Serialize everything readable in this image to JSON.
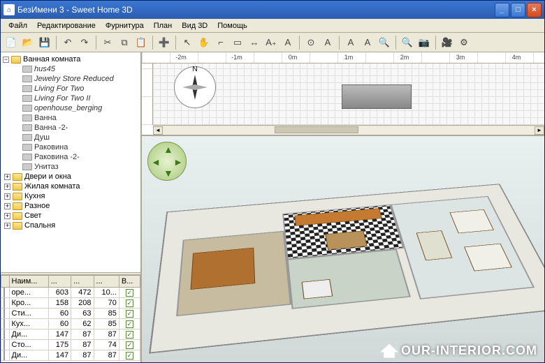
{
  "window": {
    "title": "БезИмени 3 - Sweet Home 3D"
  },
  "menubar": [
    "Файл",
    "Редактирование",
    "Фурнитура",
    "План",
    "Вид 3D",
    "Помощь"
  ],
  "toolbar_icons": [
    "new-file-icon",
    "open-icon",
    "save-icon",
    "undo-icon",
    "redo-icon",
    "cut-icon",
    "copy-icon",
    "paste-icon",
    "add-furniture-icon",
    "pointer-icon",
    "pan-icon",
    "wall-icon",
    "room-icon",
    "dimension-icon",
    "text-icon",
    "label-icon",
    "compass-icon",
    "text-edit-icon",
    "bold-icon",
    "italic-icon",
    "zoom-in-icon",
    "zoom-out-icon",
    "snapshot-icon",
    "camera-icon",
    "preferences-icon"
  ],
  "toolbar_glyphs": [
    "📄",
    "📂",
    "💾",
    "↶",
    "↷",
    "✂",
    "⧉",
    "📋",
    "➕",
    "↖",
    "✋",
    "⌐",
    "▭",
    "↔",
    "A₊",
    "A",
    "⊙",
    "A",
    "A",
    "A",
    "🔍",
    "🔍",
    "📷",
    "🎥",
    "⚙"
  ],
  "tree": {
    "root": "Ванная комната",
    "children_italic": [
      "hus45",
      "Jewelry Store Reduced",
      "Living For Two",
      "Living For Two II",
      "openhouse_berging"
    ],
    "children_plain": [
      "Ванна",
      "Ванна -2-",
      "Душ",
      "Раковина",
      "Раковина -2-",
      "Унитаз"
    ],
    "categories": [
      "Двери и окна",
      "Жилая комната",
      "Кухня",
      "Разное",
      "Свет",
      "Спальня"
    ]
  },
  "table": {
    "headers": [
      "",
      "Наим...",
      "...",
      "...",
      "...",
      "В..."
    ],
    "rows": [
      {
        "name": "оре...",
        "c1": "603",
        "c2": "472",
        "c3": "10...",
        "v": true
      },
      {
        "name": "Кро...",
        "c1": "158",
        "c2": "208",
        "c3": "70",
        "v": true
      },
      {
        "name": "Сти...",
        "c1": "60",
        "c2": "63",
        "c3": "85",
        "v": true
      },
      {
        "name": "Кух...",
        "c1": "60",
        "c2": "62",
        "c3": "85",
        "v": true
      },
      {
        "name": "Ди...",
        "c1": "147",
        "c2": "87",
        "c3": "87",
        "v": true
      },
      {
        "name": "Сто...",
        "c1": "175",
        "c2": "87",
        "c3": "74",
        "v": true
      },
      {
        "name": "Ди...",
        "c1": "147",
        "c2": "87",
        "c3": "87",
        "v": true
      }
    ]
  },
  "ruler": [
    "-2m",
    "-1m",
    "0m",
    "1m",
    "2m",
    "3m",
    "4m"
  ],
  "watermark": "OUR-INTERIOR.COM"
}
